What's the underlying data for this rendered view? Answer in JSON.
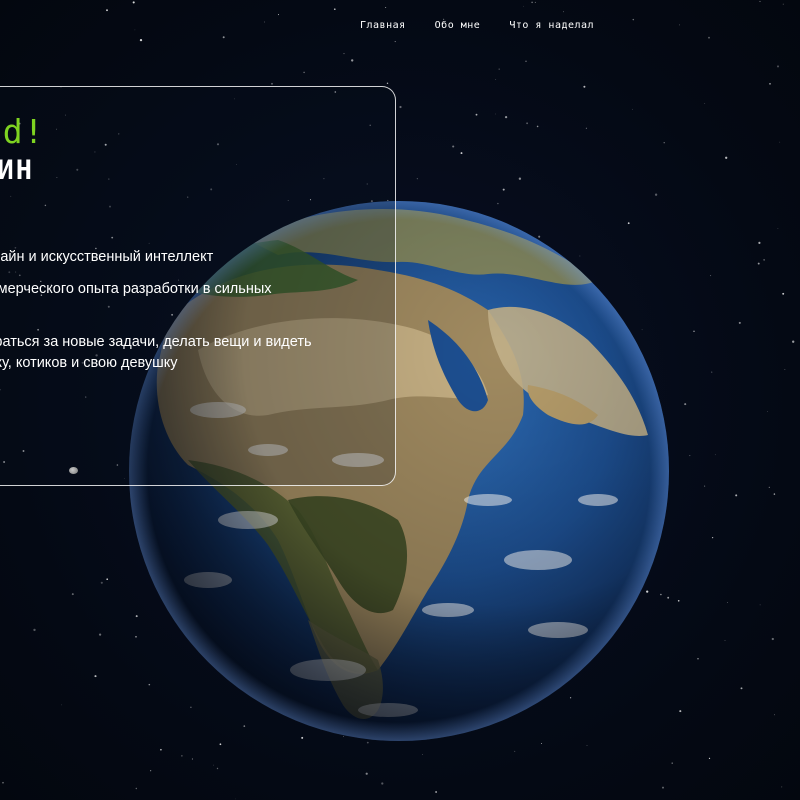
{
  "nav": {
    "items": [
      {
        "label": "Главная"
      },
      {
        "label": "Обо мне"
      },
      {
        "label": "Что я наделал"
      }
    ]
  },
  "hero": {
    "greeting_visible": "rld!",
    "name_visible": "ОВИН",
    "bio_line_1": "а, дизайн и искусственный интеллект",
    "bio_line_2": "а коммерческого опыта разработки в сильных",
    "bio_line_3a": "ты, браться за новые задачи, делать вещи и видеть",
    "bio_line_3b": "музыку, котиков и свою девушку"
  },
  "colors": {
    "background": "#050a17",
    "accent_green": "#7ed321",
    "text": "#ffffff",
    "card_border": "#ffffff"
  },
  "icons": {
    "globe": "earth-globe",
    "small_moon": "moon-dot"
  }
}
